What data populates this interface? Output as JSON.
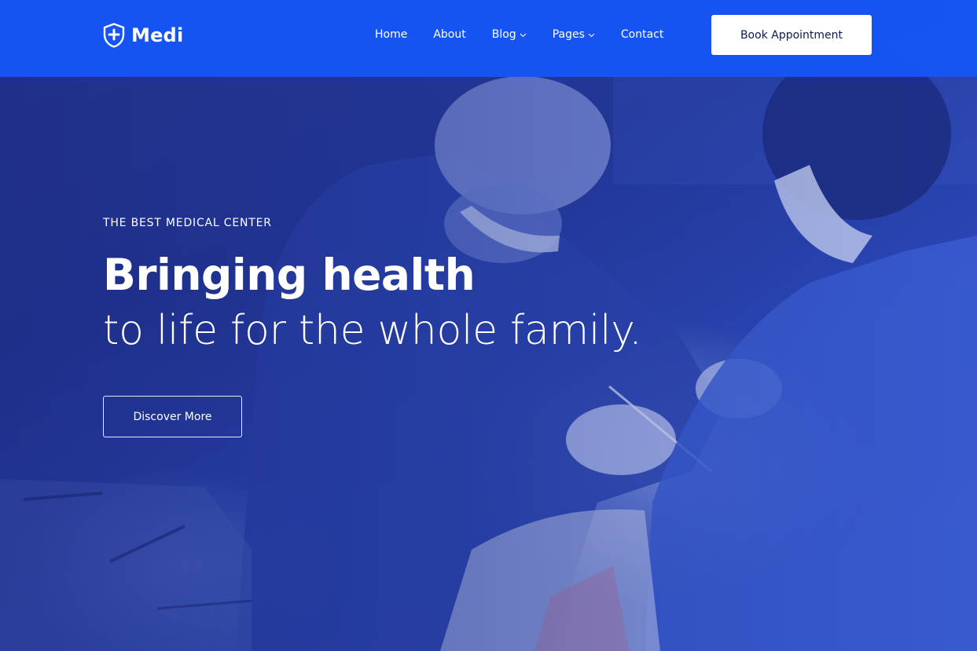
{
  "brand": {
    "name": "Medi",
    "icon": "shield-plus-icon"
  },
  "nav": {
    "items": [
      {
        "label": "Home",
        "has_dropdown": false
      },
      {
        "label": "About",
        "has_dropdown": false
      },
      {
        "label": "Blog",
        "has_dropdown": true
      },
      {
        "label": "Pages",
        "has_dropdown": true
      },
      {
        "label": "Contact",
        "has_dropdown": false
      }
    ],
    "cta_label": "Book Appointment"
  },
  "hero": {
    "eyebrow": "THE BEST MEDICAL CENTER",
    "headline_bold": "Bringing health",
    "headline_light": "to life for the whole family.",
    "button_label": "Discover More"
  },
  "colors": {
    "header_bg": "#1656F5",
    "hero_tint": "#243A9F",
    "text_on_dark": "#FFFFFF",
    "button_text": "#0B1B4F"
  }
}
